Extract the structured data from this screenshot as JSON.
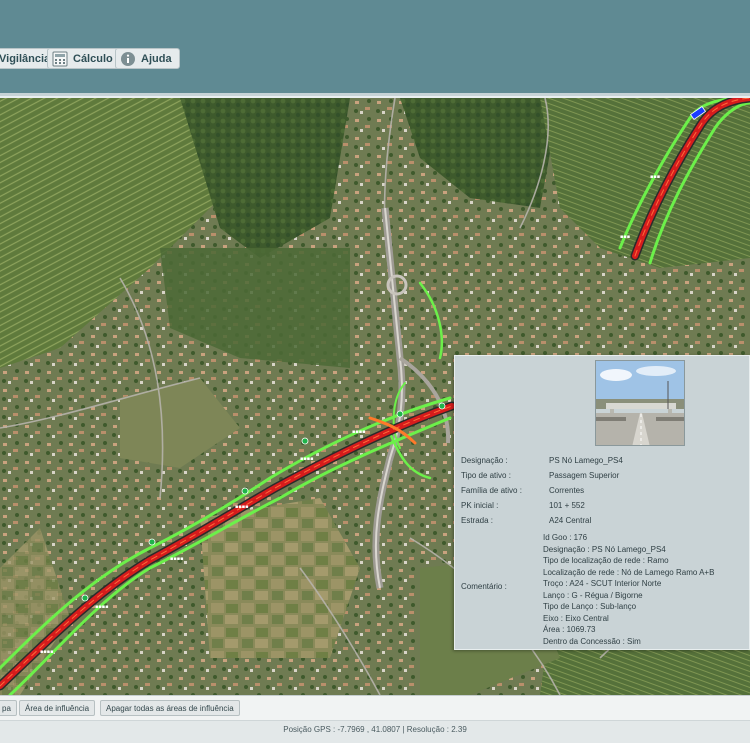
{
  "toolbar": {
    "buttons": [
      {
        "label": "Vigilância",
        "icon": "eye-icon"
      },
      {
        "label": "Cálculo",
        "icon": "calculator-icon"
      },
      {
        "label": "Ajuda",
        "icon": "info-icon"
      }
    ]
  },
  "map": {
    "road_color": "#d61c1c",
    "buffer_color": "#6cf04a",
    "marker_color": "#1a3cff"
  },
  "info_panel": {
    "fields": [
      {
        "label": "Designação :",
        "value": "PS Nó Lamego_PS4"
      },
      {
        "label": "Tipo de ativo :",
        "value": "Passagem Superior"
      },
      {
        "label": "Família de ativo :",
        "value": "Correntes"
      },
      {
        "label": "PK inicial :",
        "value": "101 + 552"
      },
      {
        "label": "Estrada :",
        "value": "A24 Central"
      }
    ],
    "comment_label": "Comentário :",
    "comment_lines": [
      "Id Goo : 176",
      "Designação : PS Nó Lamego_PS4",
      "Tipo de localização de rede : Ramo",
      "Localização de rede : Nó de Lamego Ramo A+B",
      "Troço : A24 - SCUT Interior Norte",
      "Lanço : G - Régua / Bigorne",
      "Tipo de Lanço : Sub-lanço",
      "Eixo : Eixo Central",
      "Área : 1069.73",
      "Dentro da Concessão : Sim"
    ]
  },
  "bottom": {
    "buttons": [
      "pa",
      "Área de influência",
      "Apagar todas as áreas de influência"
    ],
    "status": "Posição GPS : -7.7969 , 41.0807 | Resolução : 2.39"
  }
}
